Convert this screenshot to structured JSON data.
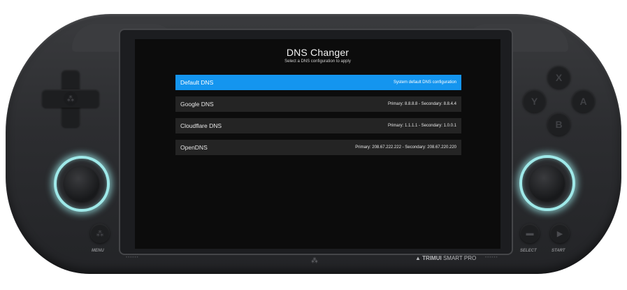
{
  "app": {
    "title": "DNS Changer",
    "subtitle": "Select a DNS configuration to apply"
  },
  "dns_options": [
    {
      "name": "Default DNS",
      "detail": "System default DNS configuration",
      "selected": true
    },
    {
      "name": "Google DNS",
      "detail": "Primary: 8.8.8.8  -  Secondary: 8.8.4.4",
      "selected": false
    },
    {
      "name": "Cloudflare DNS",
      "detail": "Primary: 1.1.1.1  -  Secondary: 1.0.0.1",
      "selected": false
    },
    {
      "name": "OpenDNS",
      "detail": "Primary: 208.67.222.222  -  Secondary: 208.67.220.220",
      "selected": false
    }
  ],
  "device": {
    "brand_prefix": "TRIMUI",
    "brand_suffix": "SMART PRO",
    "menu_label": "MENU",
    "select_label": "SELECT",
    "start_label": "START",
    "face_buttons": {
      "x": "X",
      "y": "Y",
      "a": "A",
      "b": "B"
    },
    "glow_color": "#9fe9e9",
    "accent_color": "#1495ef"
  }
}
